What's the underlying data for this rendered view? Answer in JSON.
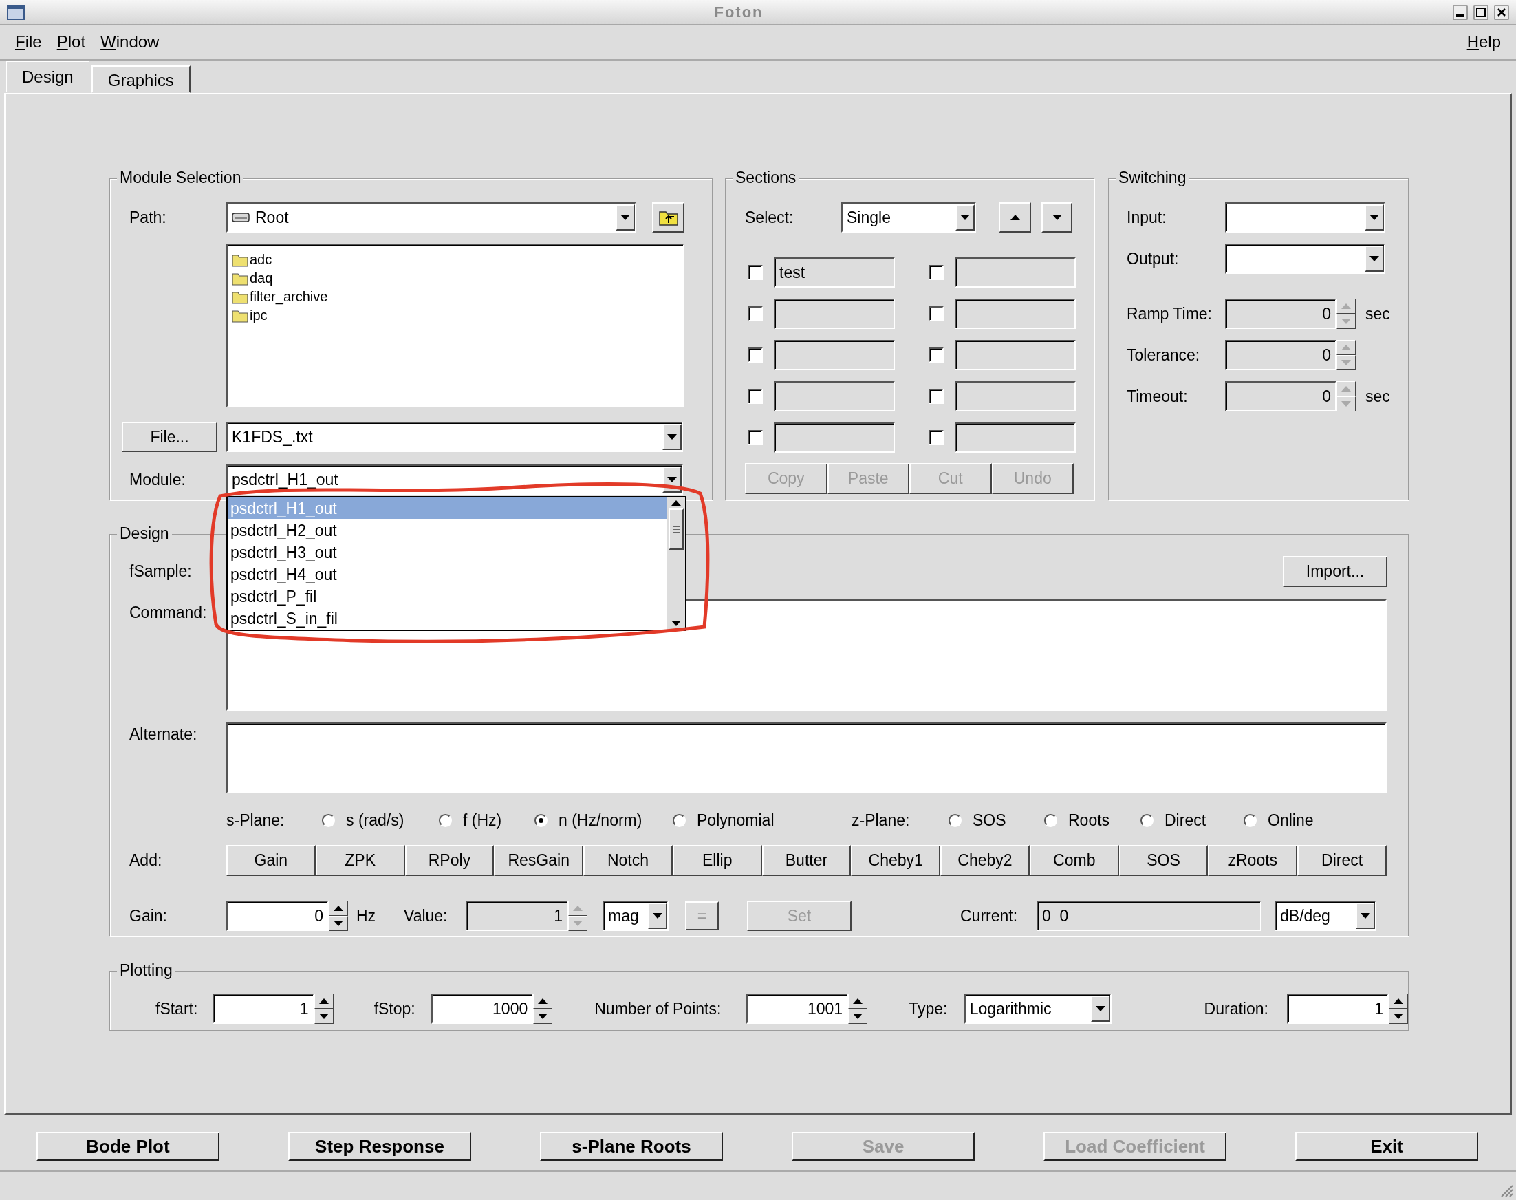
{
  "window": {
    "title": "Foton"
  },
  "menu": [
    {
      "label": "File"
    },
    {
      "label": "Plot"
    },
    {
      "label": "Window"
    }
  ],
  "help_menu": {
    "label": "Help"
  },
  "tabs": [
    {
      "label": "Design",
      "selected": true
    },
    {
      "label": "Graphics",
      "selected": false
    }
  ],
  "module_selection": {
    "title": "Module Selection",
    "path_label": "Path:",
    "path": "Root",
    "folders": [
      "adc",
      "daq",
      "filter_archive",
      "ipc"
    ],
    "file_button": "File...",
    "file": "K1FDS_.txt",
    "module_label": "Module:",
    "module": "psdctrl_H1_out",
    "module_options": [
      {
        "label": "psdctrl_H1_out",
        "selected": true
      },
      {
        "label": "psdctrl_H2_out",
        "selected": false
      },
      {
        "label": "psdctrl_H3_out",
        "selected": false
      },
      {
        "label": "psdctrl_H4_out",
        "selected": false
      },
      {
        "label": "psdctrl_P_fil",
        "selected": false
      },
      {
        "label": "psdctrl_S_in_fil",
        "selected": false
      }
    ]
  },
  "sections": {
    "title": "Sections",
    "select_label": "Select:",
    "select": "Single",
    "items": [
      {
        "checked": false,
        "value": "test"
      },
      {
        "checked": false
      },
      {
        "checked": false
      },
      {
        "checked": false
      },
      {
        "checked": false
      },
      {
        "checked": false
      },
      {
        "checked": false
      },
      {
        "checked": false
      },
      {
        "checked": false
      },
      {
        "checked": false
      }
    ],
    "buttons": [
      {
        "label": "Copy",
        "disabled": true
      },
      {
        "label": "Paste",
        "disabled": true
      },
      {
        "label": "Cut",
        "disabled": true
      },
      {
        "label": "Undo",
        "disabled": true
      }
    ]
  },
  "switching": {
    "title": "Switching",
    "input_label": "Input:",
    "output_label": "Output:",
    "fields": [
      {
        "label": "Ramp Time:",
        "value": "0",
        "unit": "sec",
        "disabled": true
      },
      {
        "label": "Tolerance:",
        "value": "0",
        "disabled": true
      },
      {
        "label": "Timeout:",
        "value": "0",
        "unit": "sec",
        "disabled": true
      }
    ]
  },
  "design": {
    "title": "Design",
    "fsample_label": "fSample:",
    "import_button": "Import...",
    "command_label": "Command:",
    "alternate_label": "Alternate:",
    "s_plane_label": "s-Plane:",
    "s_plane_options": [
      {
        "label": "s (rad/s)",
        "selected": false
      },
      {
        "label": "f (Hz)",
        "selected": false
      },
      {
        "label": "n (Hz/norm)",
        "selected": true
      },
      {
        "label": "Polynomial",
        "selected": false
      }
    ],
    "z_plane_label": "z-Plane:",
    "z_plane_options": [
      {
        "label": "SOS",
        "selected": false
      },
      {
        "label": "Roots",
        "selected": false
      },
      {
        "label": "Direct",
        "selected": false
      },
      {
        "label": "Online",
        "selected": false
      }
    ],
    "add_label": "Add:",
    "add_buttons": [
      "Gain",
      "ZPK",
      "RPoly",
      "ResGain",
      "Notch",
      "Ellip",
      "Butter",
      "Cheby1",
      "Cheby2",
      "Comb",
      "SOS",
      "zRoots",
      "Direct"
    ],
    "gain_label": "Gain:",
    "gain": "0",
    "gain_unit": "Hz",
    "value_label": "Value:",
    "value": {
      "value": "1",
      "disabled": true
    },
    "value_format": "mag",
    "equals_button": {
      "label": "=",
      "disabled": true
    },
    "set_button": {
      "label": "Set",
      "disabled": true
    },
    "current_label": "Current:",
    "current": "0  0",
    "current_format": "dB/deg"
  },
  "plotting": {
    "title": "Plotting",
    "fields": [
      {
        "kind": "spin",
        "label": "fStart:",
        "value": "1"
      },
      {
        "kind": "spin",
        "label": "fStop:",
        "value": "1000"
      },
      {
        "kind": "spin",
        "label": "Number of Points:",
        "value": "1001"
      },
      {
        "kind": "combo",
        "label": "Type:",
        "value": "Logarithmic"
      },
      {
        "kind": "spin",
        "label": "Duration:",
        "value": "1"
      }
    ]
  },
  "actions": [
    {
      "label": "Bode Plot",
      "disabled": false
    },
    {
      "label": "Step Response",
      "disabled": false
    },
    {
      "label": "s-Plane Roots",
      "disabled": false
    },
    {
      "label": "Save",
      "disabled": true
    },
    {
      "label": "Load Coefficient",
      "disabled": true
    },
    {
      "label": "Exit",
      "disabled": false
    }
  ]
}
